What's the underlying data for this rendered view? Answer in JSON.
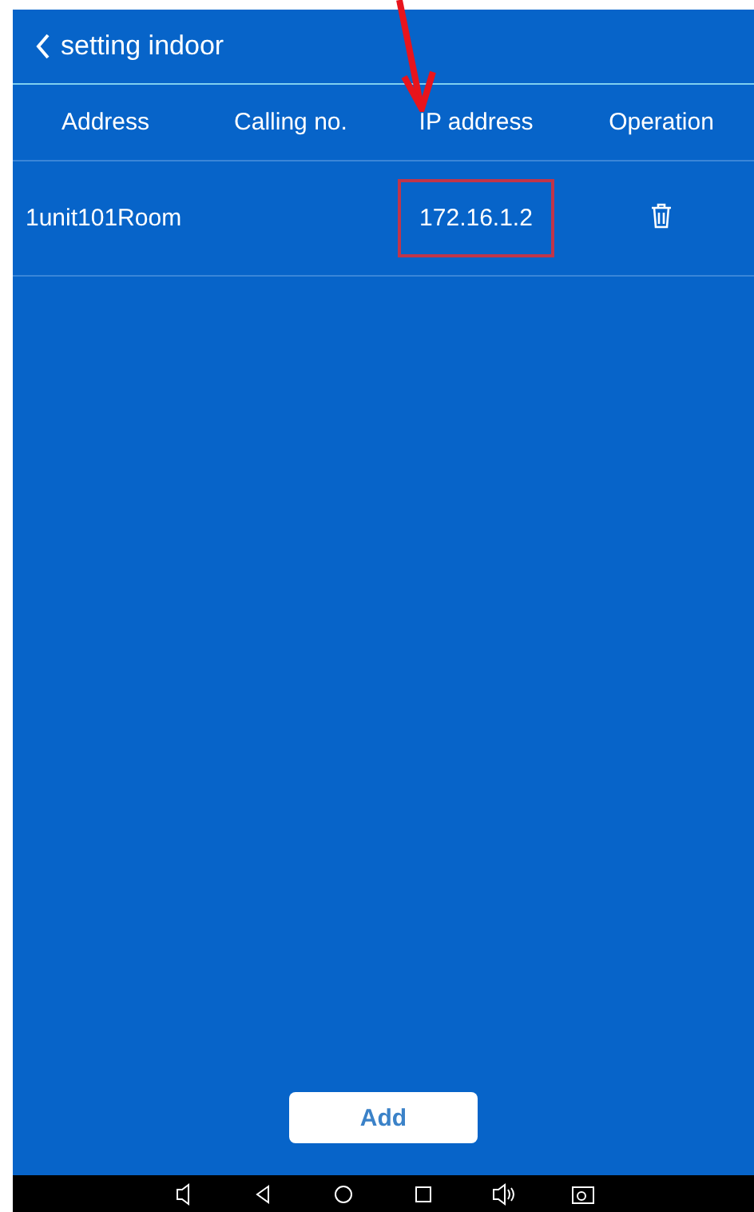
{
  "title_bar": {
    "title": "setting indoor"
  },
  "table": {
    "columns": [
      "Address",
      "Calling no.",
      "IP address",
      "Operation"
    ],
    "rows": [
      {
        "address": "1unit101Room",
        "ip_address": "172.16.1.2",
        "highlighted": true
      }
    ]
  },
  "add_button": "Add",
  "annotation": {
    "kind": "arrow"
  }
}
